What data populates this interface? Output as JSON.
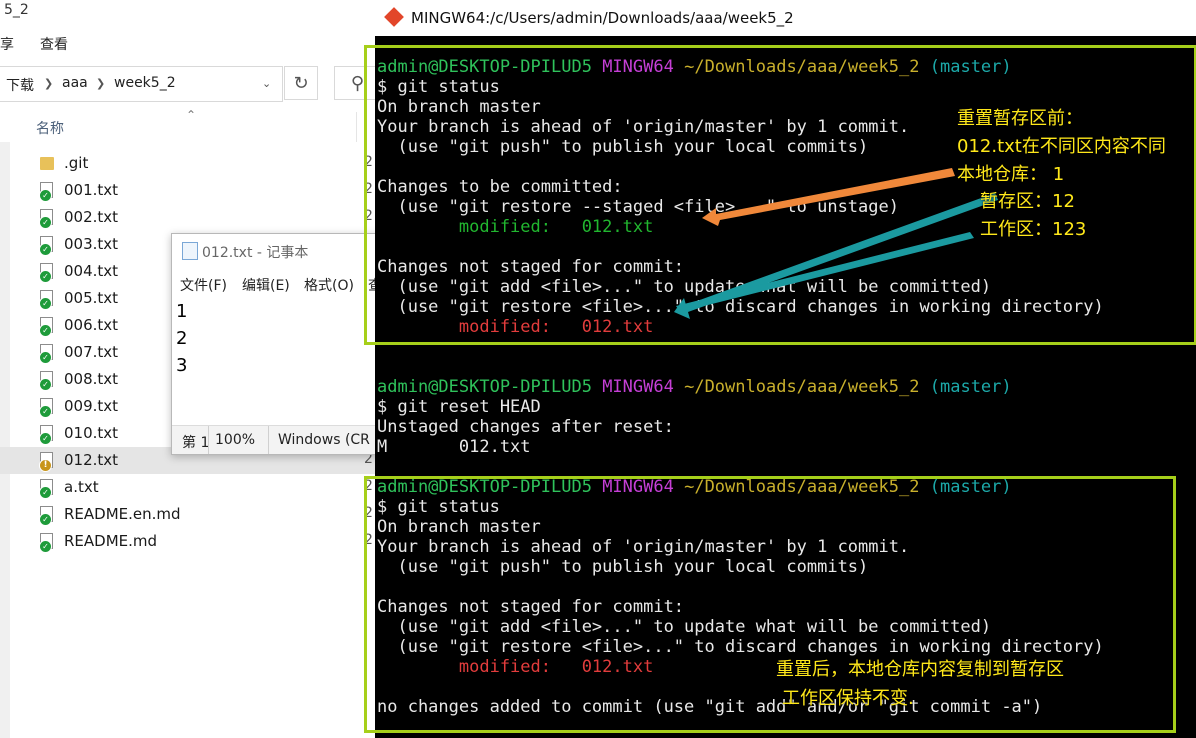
{
  "explorer": {
    "title_fragment": "5_2",
    "ribbon": {
      "share_fragment": "享",
      "view": "查看"
    },
    "breadcrumb": [
      "下载",
      "aaa",
      "week5_2"
    ],
    "column_name": "名称",
    "files": [
      {
        "name": ".git",
        "kind": "folder",
        "date": "2"
      },
      {
        "name": "001.txt",
        "kind": "ok",
        "date": "2"
      },
      {
        "name": "002.txt",
        "kind": "ok",
        "date": "2"
      },
      {
        "name": "003.txt",
        "kind": "ok",
        "date": ""
      },
      {
        "name": "004.txt",
        "kind": "ok",
        "date": ""
      },
      {
        "name": "005.txt",
        "kind": "ok",
        "date": ""
      },
      {
        "name": "006.txt",
        "kind": "ok",
        "date": ""
      },
      {
        "name": "007.txt",
        "kind": "ok",
        "date": ""
      },
      {
        "name": "008.txt",
        "kind": "ok",
        "date": ""
      },
      {
        "name": "009.txt",
        "kind": "ok",
        "date": ""
      },
      {
        "name": "010.txt",
        "kind": "ok",
        "date": ""
      },
      {
        "name": "012.txt",
        "kind": "warn",
        "date": "2"
      },
      {
        "name": "a.txt",
        "kind": "ok",
        "date": "2"
      },
      {
        "name": "README.en.md",
        "kind": "ok",
        "date": "2"
      },
      {
        "name": "README.md",
        "kind": "ok",
        "date": "2"
      }
    ]
  },
  "notepad": {
    "title": "012.txt - 记事本",
    "menu": {
      "file": "文件(F)",
      "edit": "编辑(E)",
      "format": "格式(O)",
      "view_fragment": "查"
    },
    "lines": [
      "1",
      "2",
      "3"
    ],
    "status": {
      "position_fragment": "第 1",
      "zoom": "100%",
      "encoding_fragment": "Windows (CR"
    }
  },
  "terminal": {
    "title": "MINGW64:/c/Users/admin/Downloads/aaa/week5_2",
    "prompt": {
      "user": "admin@DESKTOP-DPILUD5",
      "shell": "MINGW64",
      "path": "~/Downloads/aaa/week5_2",
      "branch": "(master)"
    },
    "block1": {
      "command": "$ git status",
      "lines": [
        "On branch master",
        "Your branch is ahead of 'origin/master' by 1 commit.",
        "  (use \"git push\" to publish your local commits)",
        "",
        "Changes to be committed:",
        "  (use \"git restore --staged <file>...\" to unstage)"
      ],
      "staged_modified": "        modified:   012.txt",
      "lines2": [
        "",
        "Changes not staged for commit:",
        "  (use \"git add <file>...\" to update what will be committed)",
        "  (use \"git restore <file>...\" to discard changes in working directory)"
      ],
      "unstaged_modified": "        modified:   012.txt"
    },
    "block2": {
      "command": "$ git reset HEAD",
      "lines": [
        "Unstaged changes after reset:",
        "M       012.txt"
      ]
    },
    "block3": {
      "command": "$ git status",
      "lines": [
        "On branch master",
        "Your branch is ahead of 'origin/master' by 1 commit.",
        "  (use \"git push\" to publish your local commits)",
        "",
        "Changes not staged for commit:",
        "  (use \"git add <file>...\" to update what will be committed)",
        "  (use \"git restore <file>...\" to discard changes in working directory)"
      ],
      "unstaged_modified": "        modified:   012.txt",
      "final": "no changes added to commit (use \"git add\" and/or \"git commit -a\")"
    }
  },
  "annotations": {
    "before": [
      "重置暂存区前：",
      "012.txt在不同区内容不同",
      "本地仓库：  1",
      "暂存区：12",
      "工作区：123"
    ],
    "after": [
      "重置后，本地仓库内容复制到暂存区",
      "工作区保持不变."
    ]
  },
  "colors": {
    "highlight_box": "#a6cf1a",
    "arrow_orange": "#f0883a",
    "arrow_teal": "#1b9aa0",
    "note_text": "#ffe81a"
  }
}
